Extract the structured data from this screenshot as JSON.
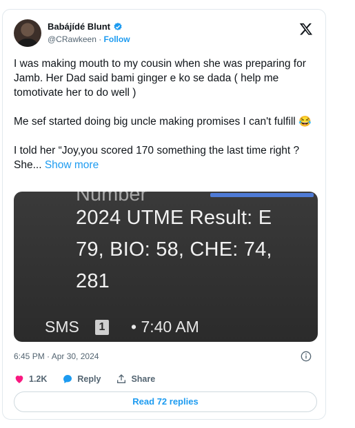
{
  "author": {
    "display_name": "Babájídé Blunt",
    "handle": "@CRawkeen",
    "separator": " · ",
    "follow_label": "Follow"
  },
  "tweet": {
    "paragraphs": [
      "I was making mouth to my cousin when she was preparing for Jamb. Her Dad said bami ginger e ko se dada ( help me tomotivate her to do well )",
      "Me sef started doing big uncle making promises I can't fulfill",
      "I told her “Joy,you scored 170 something the last time right ? She..."
    ],
    "emoji": "😂",
    "show_more_label": "Show more"
  },
  "media": {
    "faded_line": "Number ",
    "line1": "2024 UTME Result: E",
    "line2": "79, BIO: 58, CHE: 74, ",
    "line3": "281",
    "sms_label": "SMS",
    "sim_number": "1",
    "time": "• 7:40 AM"
  },
  "timestamp": "6:45 PM · Apr 30, 2024",
  "actions": {
    "like_count": "1.2K",
    "reply_label": "Reply",
    "share_label": "Share"
  },
  "read_replies_label": "Read 72 replies",
  "colors": {
    "accent": "#1d9bf0",
    "like": "#f91880",
    "muted": "#536471"
  }
}
